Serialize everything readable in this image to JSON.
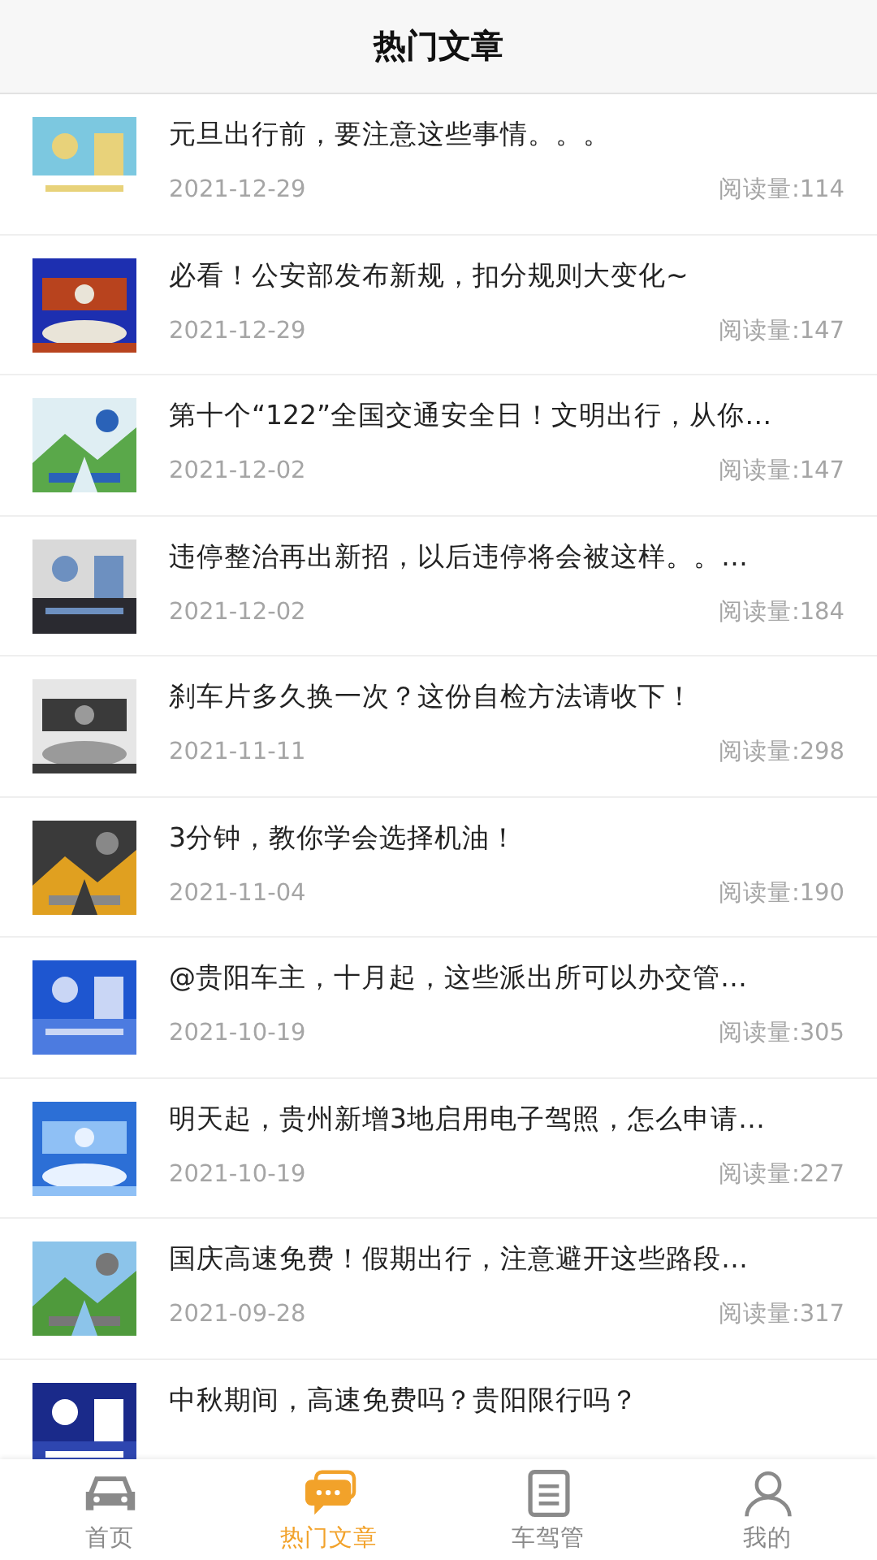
{
  "header": {
    "title": "热门文章"
  },
  "articles": [
    {
      "title": "元旦出行前，要注意这些事情。。。",
      "date": "2021-12-29",
      "reads": "阅读量:114"
    },
    {
      "title": "必看！公安部发布新规，扣分规则大变化~",
      "date": "2021-12-29",
      "reads": "阅读量:147"
    },
    {
      "title": "第十个“122”全国交通安全日！文明出行，从你…",
      "date": "2021-12-02",
      "reads": "阅读量:147"
    },
    {
      "title": "违停整治再出新招，以后违停将会被这样。。…",
      "date": "2021-12-02",
      "reads": "阅读量:184"
    },
    {
      "title": "刹车片多久换一次？这份自检方法请收下！",
      "date": "2021-11-11",
      "reads": "阅读量:298"
    },
    {
      "title": "3分钟，教你学会选择机油！",
      "date": "2021-11-04",
      "reads": "阅读量:190"
    },
    {
      "title": "@贵阳车主，十月起，这些派出所可以办交管…",
      "date": "2021-10-19",
      "reads": "阅读量:305"
    },
    {
      "title": "明天起，贵州新增3地启用电子驾照，怎么申请…",
      "date": "2021-10-19",
      "reads": "阅读量:227"
    },
    {
      "title": "国庆高速免费！假期出行，注意避开这些路段…",
      "date": "2021-09-28",
      "reads": "阅读量:317"
    },
    {
      "title": "中秋期间，高速免费吗？贵阳限行吗？"
    }
  ],
  "tabs": [
    {
      "label": "首页",
      "kind": "car",
      "selected": false
    },
    {
      "label": "热门文章",
      "kind": "chat",
      "selected": true
    },
    {
      "label": "车驾管",
      "kind": "document",
      "selected": false
    },
    {
      "label": "我的",
      "kind": "person",
      "selected": false
    }
  ]
}
